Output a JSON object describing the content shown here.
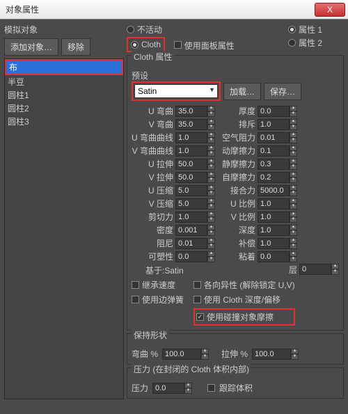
{
  "window": {
    "title": "对象属性",
    "close": "X"
  },
  "left": {
    "section": "模拟对象",
    "add": "添加对象…",
    "remove": "移除",
    "items": [
      "布",
      "半豆",
      "圆柱1",
      "圆柱2",
      "圆柱3"
    ]
  },
  "topRadios": {
    "inactive": "不活动",
    "cloth": "Cloth",
    "usePanel": "使用面板属性",
    "attr1": "属性 1",
    "attr2": "属性 2"
  },
  "clothProps": {
    "title": "Cloth 属性",
    "presetLabel": "预设",
    "preset": "Satin",
    "load": "加载…",
    "save": "保存…",
    "leftParams": [
      {
        "label": "U 弯曲",
        "val": "35.0"
      },
      {
        "label": "V 弯曲",
        "val": "35.0"
      },
      {
        "label": "U 弯曲曲线",
        "val": "1.0"
      },
      {
        "label": "V 弯曲曲线",
        "val": "1.0"
      },
      {
        "label": "U 拉伸",
        "val": "50.0"
      },
      {
        "label": "V 拉伸",
        "val": "50.0"
      },
      {
        "label": "U 压缩",
        "val": "5.0"
      },
      {
        "label": "V 压缩",
        "val": "5.0"
      },
      {
        "label": "剪切力",
        "val": "1.0"
      },
      {
        "label": "密度",
        "val": "0.001"
      },
      {
        "label": "阻尼",
        "val": "0.01"
      },
      {
        "label": "可塑性",
        "val": "0.0"
      }
    ],
    "rightParams": [
      {
        "label": "厚度",
        "val": "0.0"
      },
      {
        "label": "排斥",
        "val": "1.0"
      },
      {
        "label": "空气阻力",
        "val": "0.01"
      },
      {
        "label": "动摩擦力",
        "val": "0.1"
      },
      {
        "label": "静摩擦力",
        "val": "0.3"
      },
      {
        "label": "自摩擦力",
        "val": "0.2"
      },
      {
        "label": "接合力",
        "val": "5000.0"
      },
      {
        "label": "U 比例",
        "val": "1.0"
      },
      {
        "label": "V 比例",
        "val": "1.0"
      },
      {
        "label": "深度",
        "val": "1.0"
      },
      {
        "label": "补偿",
        "val": "1.0"
      },
      {
        "label": "粘着",
        "val": "0.0"
      }
    ],
    "basedOnLabel": "基于:",
    "basedOn": "Satin",
    "layerLabel": "层",
    "layerVal": "0",
    "checks": {
      "inheritVel": "继承速度",
      "aniso": "各向异性 (解除锁定 U,V)",
      "edgeSpring": "使用边弹簧",
      "clothDepth": "使用 Cloth 深度/偏移",
      "collisionFriction": "使用碰撞对象摩擦"
    }
  },
  "keepShape": {
    "title": "保持形状",
    "bend": "弯曲 %",
    "bendVal": "100.0",
    "stretch": "拉伸 %",
    "stretchVal": "100.0"
  },
  "pressure": {
    "title": "压力 (在封闭的 Cloth 体积内部)",
    "label": "压力",
    "val": "0.0",
    "track": "跟踪体积"
  }
}
